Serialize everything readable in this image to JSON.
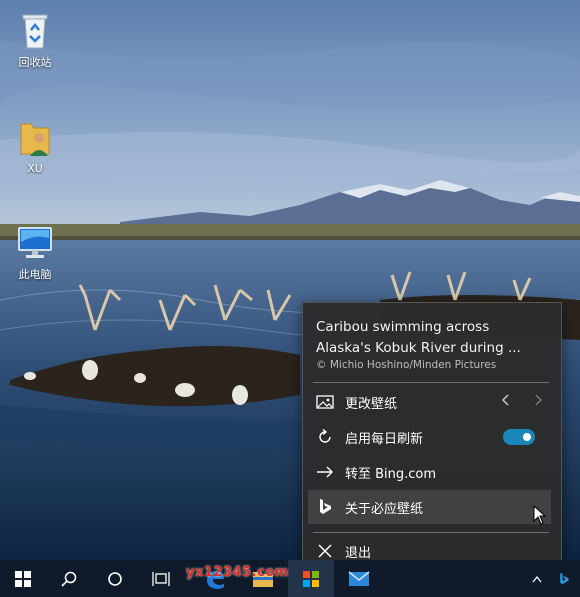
{
  "desktop": {
    "icons": [
      {
        "label": "回收站",
        "icon": "recycle-bin-icon"
      },
      {
        "label": "XU",
        "icon": "user-folder-icon"
      },
      {
        "label": "此电脑",
        "icon": "this-pc-icon"
      }
    ]
  },
  "menu": {
    "caption_line1": "Caribou swimming across",
    "caption_line2": "Alaska's Kobuk River during ...",
    "credit": "©  Michio Hoshino/Minden Pictures",
    "items": [
      {
        "label": "更改壁纸",
        "icon": "picture-icon"
      },
      {
        "label": "启用每日刷新",
        "icon": "refresh-icon",
        "toggle_on": true
      },
      {
        "label": "转至 Bing.com",
        "icon": "arrow-right-icon"
      },
      {
        "label": "关于必应壁纸",
        "icon": "bing-icon"
      },
      {
        "label": "退出",
        "icon": "close-icon"
      }
    ]
  },
  "taskbar": {
    "watermark": "yx12345.com"
  },
  "colors": {
    "menu_bg": "#2b2b2b",
    "toggle_on": "#1a86b9",
    "taskbar_bg": "#0f1b2b"
  }
}
